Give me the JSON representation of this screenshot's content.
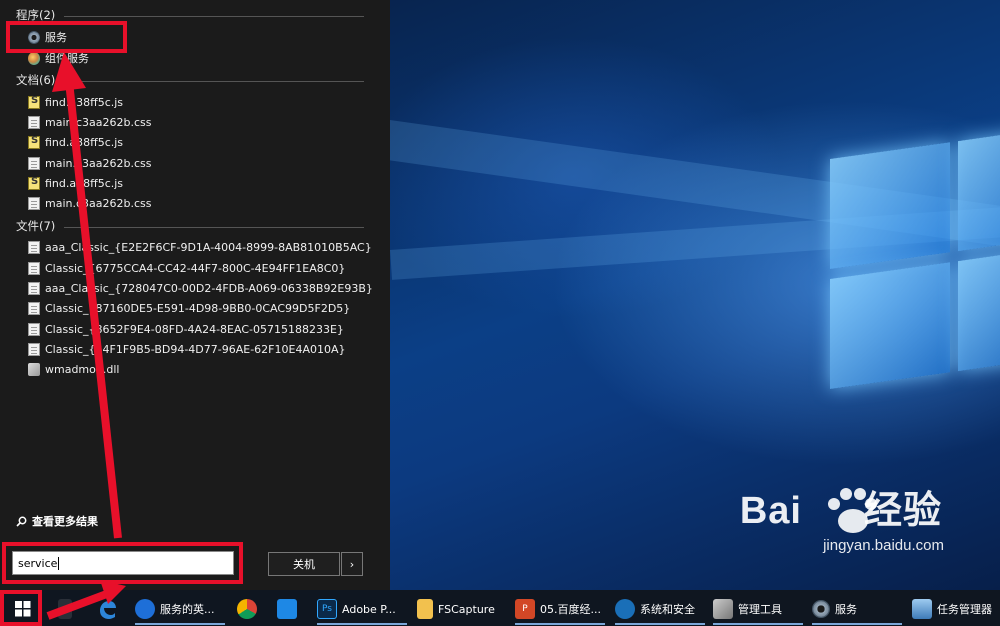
{
  "start_menu": {
    "groups": {
      "programs": {
        "header": "程序(2)",
        "items": [
          {
            "label": "服务",
            "icon": "services-gear-icon"
          },
          {
            "label": "组件服务",
            "icon": "component-services-icon"
          }
        ]
      },
      "documents": {
        "header": "文档(6)",
        "items": [
          {
            "label": "find.a38ff5c.js",
            "icon": "js-file-icon"
          },
          {
            "label": "main.c3aa262b.css",
            "icon": "css-file-icon"
          },
          {
            "label": "find.a38ff5c.js",
            "icon": "js-file-icon"
          },
          {
            "label": "main.c3aa262b.css",
            "icon": "css-file-icon"
          },
          {
            "label": "find.a38ff5c.js",
            "icon": "js-file-icon"
          },
          {
            "label": "main.c3aa262b.css",
            "icon": "css-file-icon"
          }
        ]
      },
      "files": {
        "header": "文件(7)",
        "items": [
          {
            "label": "aaa_Classic_{E2E2F6CF-9D1A-4004-8999-8AB81010B5AC}",
            "icon": "file-icon"
          },
          {
            "label": "Classic_{6775CCA4-CC42-44F7-800C-4E94FF1EA8C0}",
            "icon": "file-icon"
          },
          {
            "label": "aaa_Classic_{728047C0-00D2-4FDB-A069-06338B92E93B}",
            "icon": "file-icon"
          },
          {
            "label": "Classic_{87160DE5-E591-4D98-9BB0-0CAC99D5F2D5}",
            "icon": "file-icon"
          },
          {
            "label": "Classic_{8652F9E4-08FD-4A24-8EAC-05715188233E}",
            "icon": "file-icon"
          },
          {
            "label": "Classic_{34F1F9B5-BD94-4D77-96AE-62F10E4A010A}",
            "icon": "file-icon"
          },
          {
            "label": "wmadmod.dll",
            "icon": "dll-file-icon"
          }
        ]
      }
    },
    "more_results": "查看更多结果",
    "search": {
      "value": "service"
    },
    "shutdown_label": "关机",
    "shutdown_arrow": "›"
  },
  "taskbar": {
    "items": [
      {
        "label": "服务的英...",
        "icon": "sogou-search-icon"
      },
      {
        "label": "",
        "icon": "chrome-icon"
      },
      {
        "label": "",
        "icon": "star-app-icon"
      },
      {
        "label": "Adobe P...",
        "icon": "photoshop-icon"
      },
      {
        "label": "FSCapture",
        "icon": "fscapture-icon"
      },
      {
        "label": "05.百度经...",
        "icon": "powerpoint-icon"
      },
      {
        "label": "系统和安全",
        "icon": "system-security-icon"
      },
      {
        "label": "管理工具",
        "icon": "admin-tools-icon"
      },
      {
        "label": "服务",
        "icon": "services-icon"
      },
      {
        "label": "任务管理器",
        "icon": "task-manager-icon"
      }
    ]
  },
  "watermark": {
    "brand": "Bai",
    "brand2": "经验",
    "url": "jingyan.baidu.com"
  },
  "colors": {
    "annotation_red": "#e8102a",
    "menu_bg": "#1b1b1b",
    "taskbar_bg": "#0f1620"
  }
}
